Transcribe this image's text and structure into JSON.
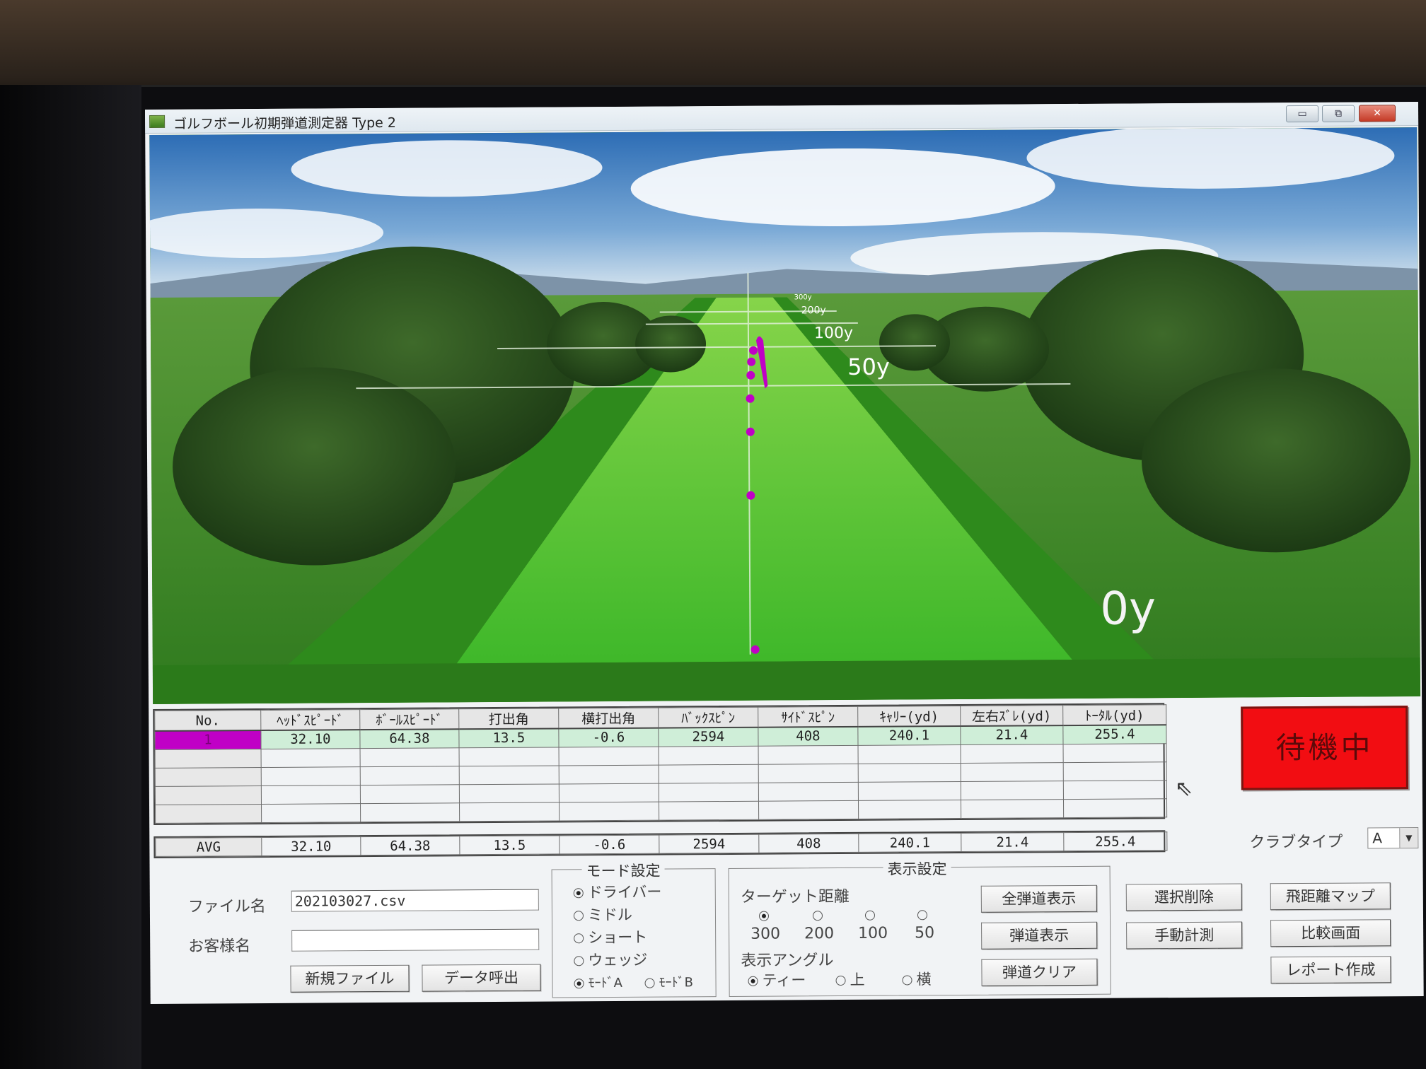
{
  "window": {
    "title": "ゴルフボール初期弾道測定器 Type 2",
    "btn_min": "▭",
    "btn_max": "⧉",
    "btn_close": "✕"
  },
  "scene": {
    "distance_labels": [
      "300y",
      "200y",
      "100y",
      "50y",
      "0y"
    ],
    "trajectory_color": "#c000c6"
  },
  "table": {
    "headers": [
      "No.",
      "ﾍｯﾄﾞｽﾋﾟｰﾄﾞ",
      "ﾎﾞｰﾙｽﾋﾟｰﾄﾞ",
      "打出角",
      "横打出角",
      "ﾊﾞｯｸｽﾋﾟﾝ",
      "ｻｲﾄﾞｽﾋﾟﾝ",
      "ｷｬﾘｰ(yd)",
      "左右ｽﾞﾚ(yd)",
      "ﾄｰﾀﾙ(yd)"
    ],
    "rows": [
      [
        "1",
        "32.10",
        "64.38",
        "13.5",
        "-0.6",
        "2594",
        "408",
        "240.1",
        "21.4",
        "255.4"
      ]
    ],
    "avg": [
      "AVG",
      "32.10",
      "64.38",
      "13.5",
      "-0.6",
      "2594",
      "408",
      "240.1",
      "21.4",
      "255.4"
    ]
  },
  "status": {
    "label": "待機中",
    "color": "#f20d12"
  },
  "club_type": {
    "label": "クラブタイプ",
    "value": "A"
  },
  "file": {
    "file_label": "ファイル名",
    "file_value": "202103027.csv",
    "customer_label": "お客様名",
    "customer_value": "",
    "new_file": "新規ファイル",
    "load_data": "データ呼出"
  },
  "mode": {
    "title": "モード設定",
    "options": [
      "ドライバー",
      "ミドル",
      "ショート",
      "ウェッジ"
    ],
    "selected": "ドライバー",
    "mode_a": "ﾓｰﾄﾞA",
    "mode_b": "ﾓｰﾄﾞB"
  },
  "display": {
    "title": "表示設定",
    "target_label": "ターゲット距離",
    "targets": [
      "300",
      "200",
      "100",
      "50"
    ],
    "angle_label": "表示アングル",
    "angles": [
      "ティー",
      "上",
      "横"
    ],
    "btn_all": "全弾道表示",
    "btn_show": "弾道表示",
    "btn_clear": "弾道クリア"
  },
  "actions": {
    "delete": "選択削除",
    "manual": "手動計測",
    "map": "飛距離マップ",
    "compare": "比較画面",
    "report": "レポート作成"
  }
}
